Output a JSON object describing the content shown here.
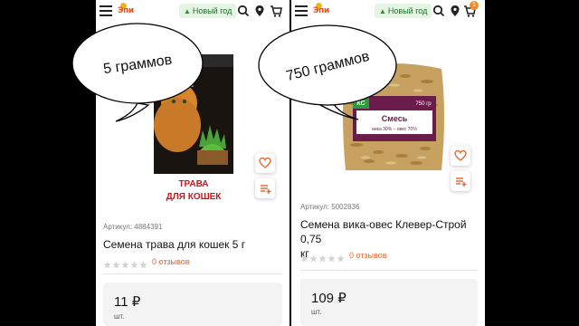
{
  "header": {
    "logo_text": "Эпи",
    "pill_label": "Новый год",
    "cart_count": "1"
  },
  "product1": {
    "pack_title": "ТРАВА",
    "pack_subtitle": "ДЛЯ КОШЕК",
    "article": "Артикул: 4884391",
    "title": "Семена трава для кошек 5 г",
    "reviews": "0 отзывов",
    "price": "11 ₽",
    "unit": "шт."
  },
  "product2": {
    "pack_brand": "КС",
    "pack_weight": "750 гр",
    "pack_title": "Смесь",
    "pack_subtitle": "вика 30% – овес 70%",
    "article": "Артикул: 5002836",
    "title_line1": "Семена вика-овес Клевер-Строй 0,75",
    "title_line2": "кг",
    "reviews": "0 отзывов",
    "price": "109 ₽",
    "unit": "шт."
  },
  "annotations": {
    "left": "5 граммов",
    "right": "750 граммов"
  },
  "colors": {
    "accent": "#e8642a",
    "pill_bg": "#e6f4e4",
    "pill_text": "#1f6f2a",
    "pack_red": "#c8161d"
  },
  "icons": [
    "hamburger-icon",
    "search-icon",
    "location-pin-icon",
    "cart-icon",
    "heart-icon",
    "compare-icon",
    "star-icon"
  ]
}
